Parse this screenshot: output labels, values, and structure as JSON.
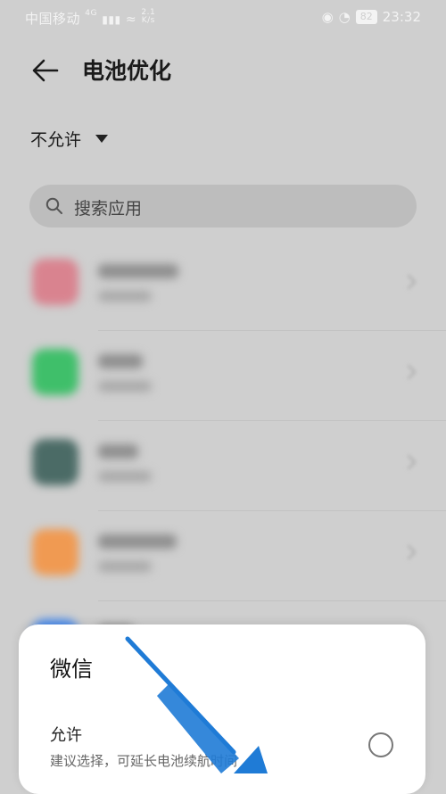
{
  "status": {
    "carrier": "中国移动",
    "network": "4G",
    "speed_value": "2.1",
    "speed_unit": "K/s",
    "battery": "82",
    "time": "23:32"
  },
  "header": {
    "back_icon": "arrow-left-icon",
    "title": "电池优化"
  },
  "filter": {
    "selected": "不允许",
    "dropdown_icon": "triangle-down-icon"
  },
  "search": {
    "icon": "search-icon",
    "placeholder": "搜索应用"
  },
  "app_list": {
    "icon_colors": [
      "#d9838f",
      "#3fbf6a",
      "#4b6b66",
      "#f09a52",
      "#4a8df0"
    ]
  },
  "sheet": {
    "title": "微信",
    "option": {
      "label": "允许",
      "description": "建议选择，可延长电池续航时间"
    }
  },
  "annotation": {
    "arrow_color": "#1f7bd6"
  }
}
